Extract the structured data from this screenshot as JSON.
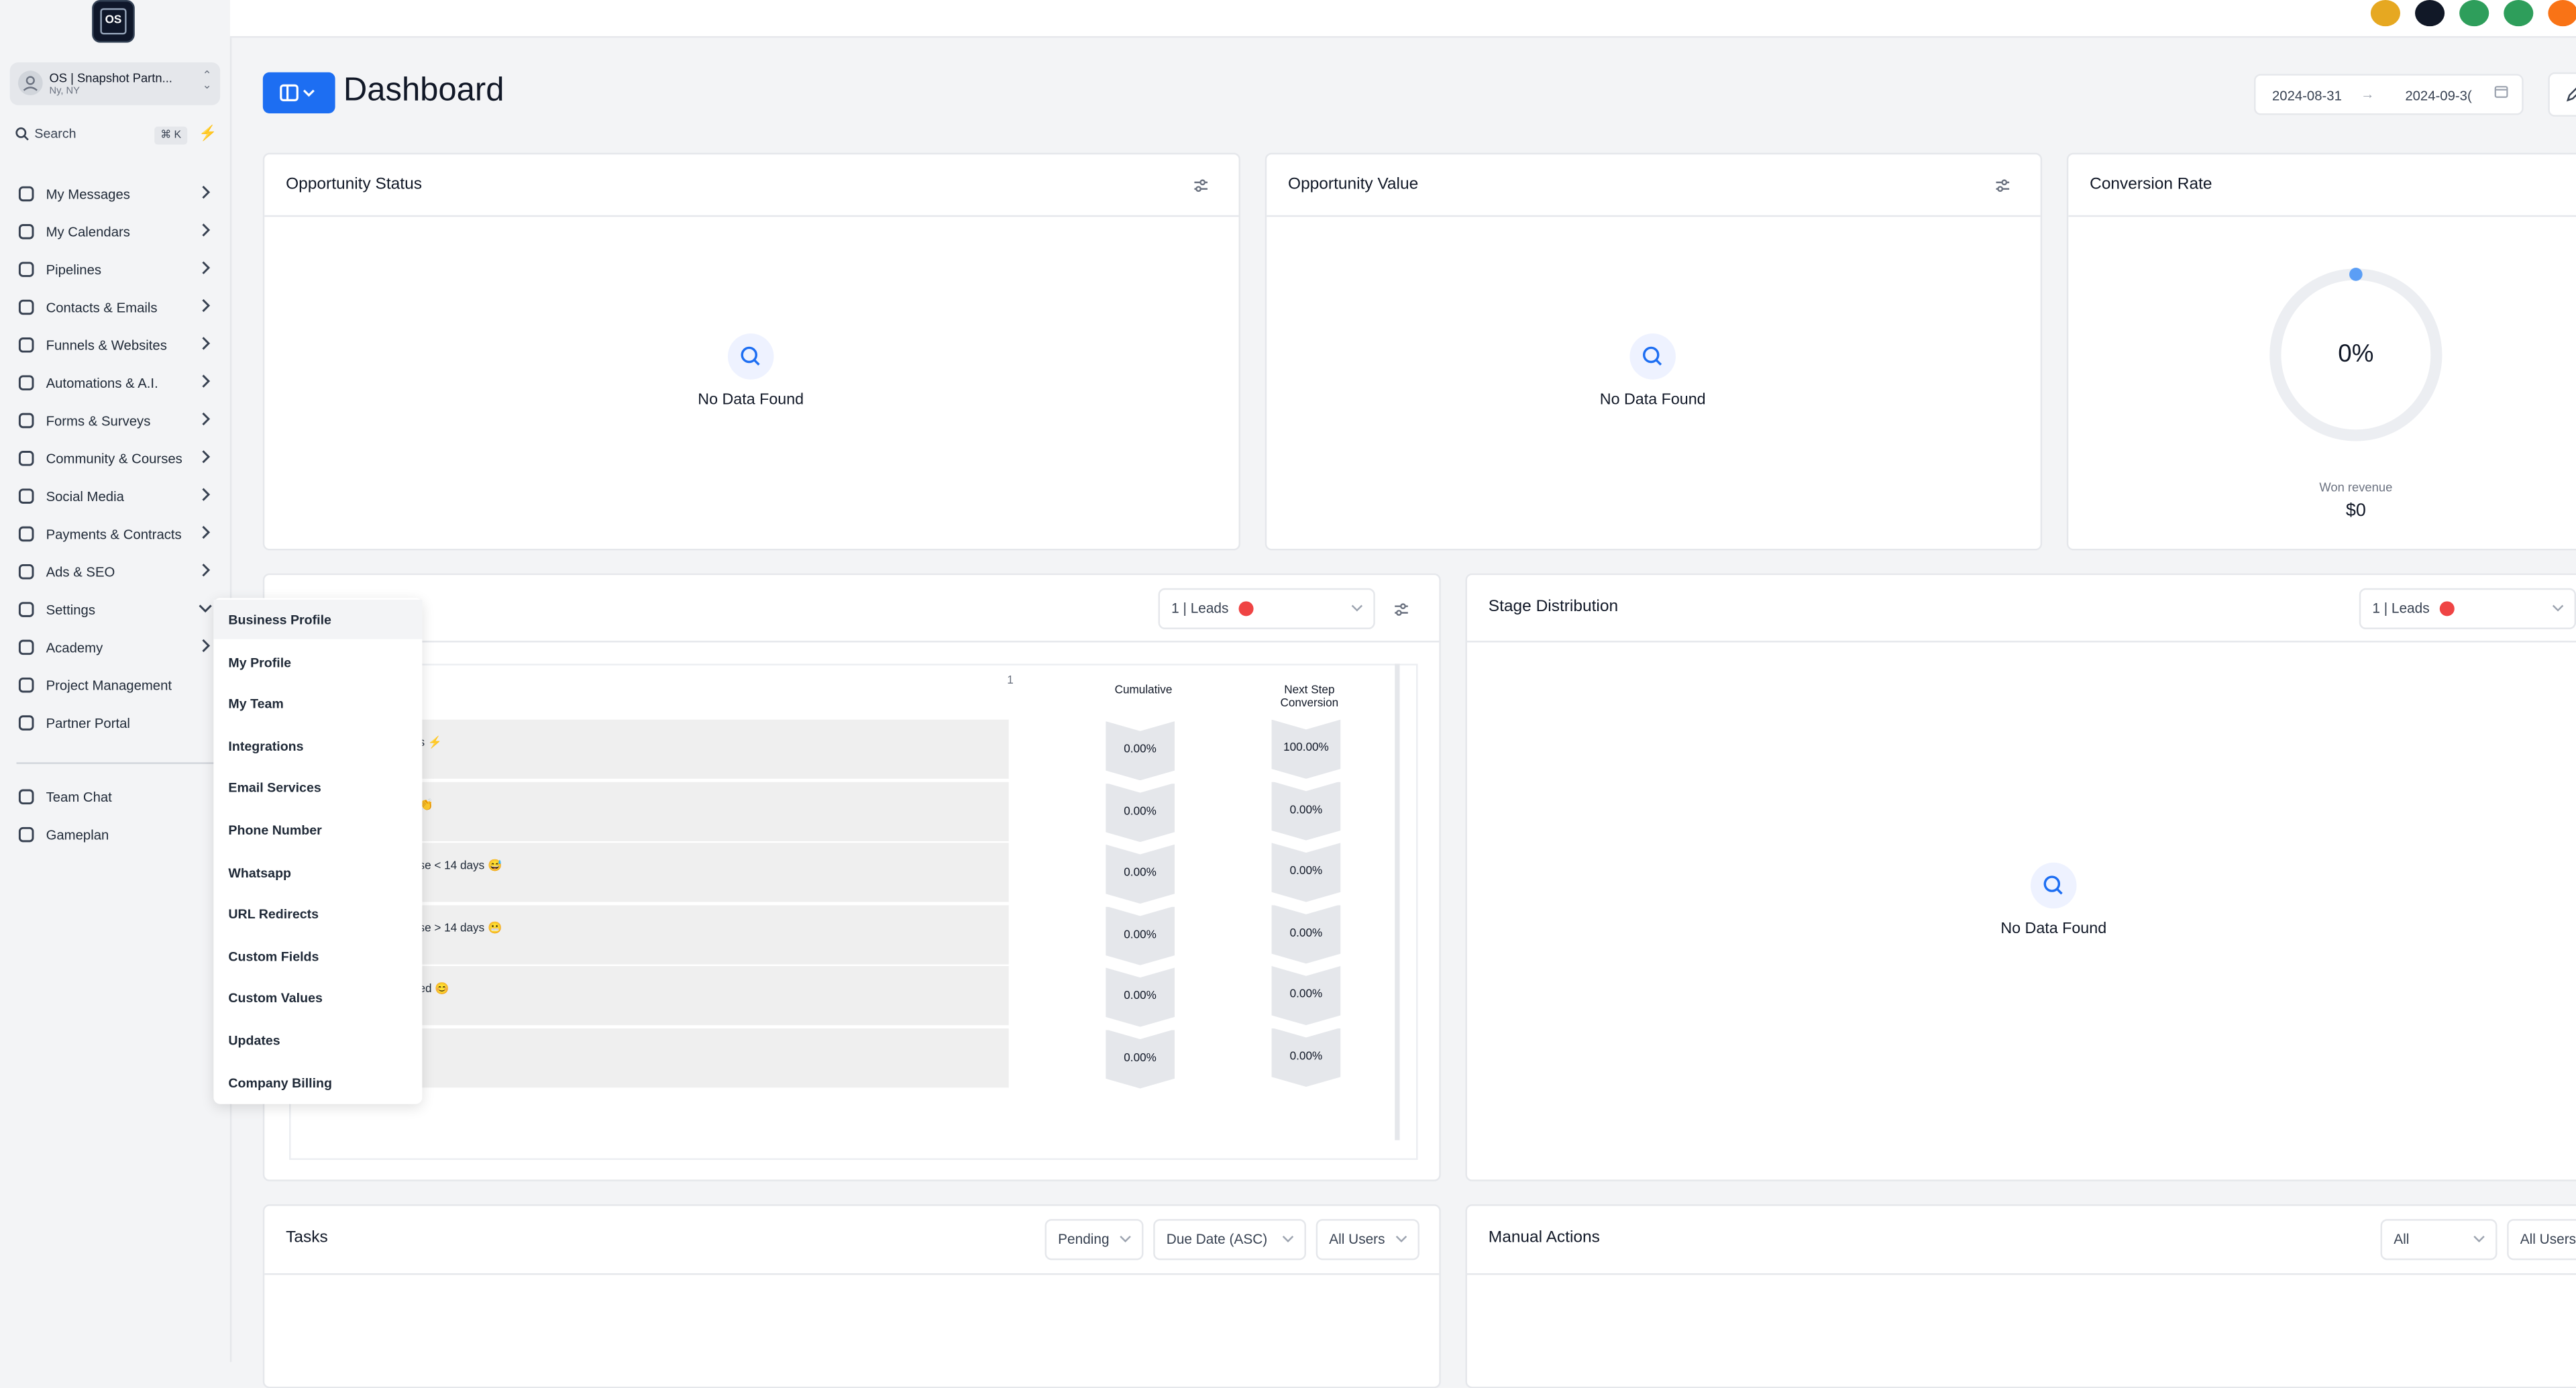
{
  "sidebar": {
    "logo_text": "OS",
    "account": {
      "name": "OS | Snapshot Partn...",
      "location": "Ny, NY"
    },
    "search": {
      "label": "Search",
      "shortcut": "⌘ K"
    },
    "items": [
      {
        "label": "My Messages",
        "icon": "chat-bubbles-icon"
      },
      {
        "label": "My Calendars",
        "icon": "calendar-icon"
      },
      {
        "label": "Pipelines",
        "icon": "droplet-icon"
      },
      {
        "label": "Contacts & Emails",
        "icon": "mail-icon"
      },
      {
        "label": "Funnels & Websites",
        "icon": "laptop-icon"
      },
      {
        "label": "Automations & A.I.",
        "icon": "rocket-icon"
      },
      {
        "label": "Forms & Surveys",
        "icon": "form-icon"
      },
      {
        "label": "Community & Courses",
        "icon": "community-icon"
      },
      {
        "label": "Social Media",
        "icon": "apple-icon"
      },
      {
        "label": "Payments & Contracts",
        "icon": "dollar-icon"
      },
      {
        "label": "Ads & SEO",
        "icon": "ad-icon"
      },
      {
        "label": "Settings",
        "icon": "gears-icon"
      },
      {
        "label": "Academy",
        "icon": "academy-icon"
      },
      {
        "label": "Project Management",
        "icon": "target-icon"
      },
      {
        "label": "Partner Portal",
        "icon": "handshake-icon"
      }
    ],
    "bottom_items": [
      {
        "label": "Team Chat",
        "icon": "chat-icon"
      },
      {
        "label": "Gameplan",
        "icon": "basket-icon"
      }
    ]
  },
  "settings_menu": [
    "Business Profile",
    "My Profile",
    "My Team",
    "Integrations",
    "Email Services",
    "Phone Number",
    "Whatsapp",
    "URL Redirects",
    "Custom Fields",
    "Custom Values",
    "Updates",
    "Company Billing"
  ],
  "header": {
    "title": "Dashboard",
    "date_start": "2024-08-31",
    "date_end": "2024-09-3("
  },
  "cards": {
    "opportunity_status": {
      "title": "Opportunity Status",
      "empty": "No Data Found"
    },
    "opportunity_value": {
      "title": "Opportunity Value",
      "empty": "No Data Found"
    },
    "conversion_rate": {
      "title": "Conversion Rate",
      "value": "0%",
      "revenue_label": "Won revenue",
      "revenue_value": "$0",
      "rate_fraction": 0.0
    },
    "funnel": {
      "pipeline_select": "1 | Leads",
      "count_label": "1",
      "cumulative_header": "Cumulative",
      "next_step_header": "Next Step\nConversion",
      "rows": [
        {
          "stage": "s ⚡",
          "cumulative": "0.00%",
          "next": "100.00%"
        },
        {
          "stage": "👏",
          "cumulative": "0.00%",
          "next": "0.00%"
        },
        {
          "stage": "se < 14 days 😅",
          "cumulative": "0.00%",
          "next": "0.00%"
        },
        {
          "stage": "se > 14 days 😬",
          "cumulative": "0.00%",
          "next": "0.00%"
        },
        {
          "stage": "ed 😊",
          "cumulative": "0.00%",
          "next": "0.00%"
        },
        {
          "stage": "",
          "cumulative": "0.00%",
          "next": "0.00%"
        }
      ]
    },
    "stage_distribution": {
      "title": "Stage Distribution",
      "pipeline_select": "1 | Leads",
      "empty": "No Data Found"
    },
    "tasks": {
      "title": "Tasks",
      "status_filter": "Pending",
      "sort": "Due Date (ASC)",
      "users": "All Users"
    },
    "manual_actions": {
      "title": "Manual Actions",
      "filter": "All",
      "users": "All Users"
    }
  },
  "colors": {
    "accent": "#1d6ef2",
    "top_icons": [
      "#e6a821",
      "#111827",
      "#2e9e5b",
      "#2e9e5b",
      "#f97316"
    ]
  }
}
